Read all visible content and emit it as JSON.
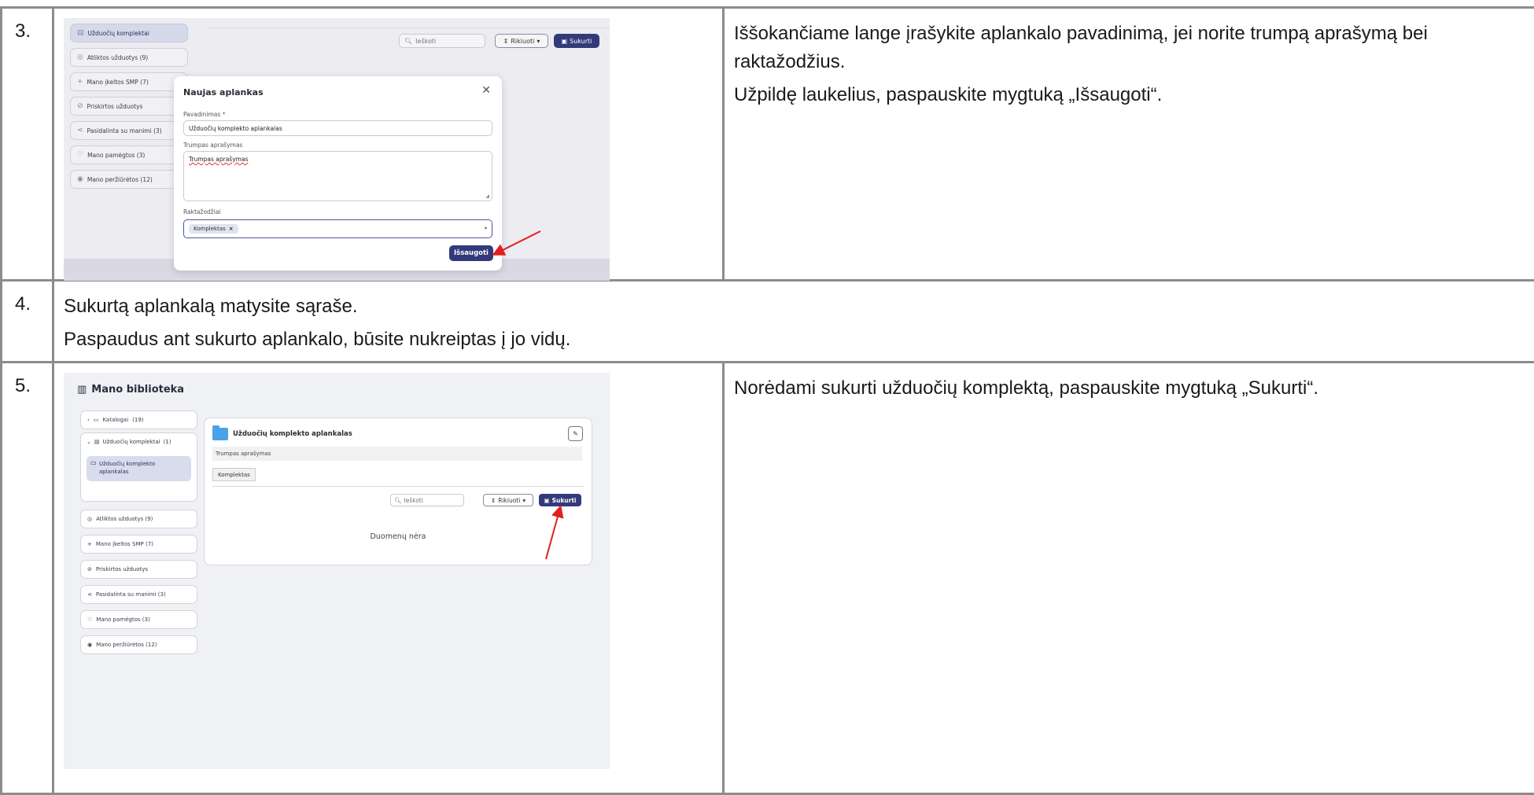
{
  "rows": [
    {
      "number": "3.",
      "text": [
        "Iššokančiame lange įrašykite aplankalo pavadinimą, jei norite trumpą aprašymą bei raktažodžius.",
        "Užpildę laukelius, paspauskite mygtuką „Išsaugoti“."
      ]
    },
    {
      "number": "4.",
      "text": [
        "Sukurtą aplankalą matysite sąraše.",
        "Paspaudus ant sukurto aplankalo, būsite nukreiptas į jo vidų."
      ]
    },
    {
      "number": "5.",
      "text": [
        "Norėdami sukurti užduočių komplektą, paspauskite mygtuką „Sukurti“."
      ]
    }
  ],
  "screenshot3": {
    "sidebar": [
      "Užduočių komplektai",
      "Atliktos užduotys (9)",
      "Mano įkeltos SMP (7)",
      "Priskirtos užduotys",
      "Pasidalinta su manimi (3)",
      "Mano pamėgtos (3)",
      "Mano peržiūrėtos (12)"
    ],
    "search_placeholder": "Ieškoti",
    "sort_label": "Rikiuoti",
    "create_label": "Sukurti",
    "modal": {
      "title": "Naujas aplankas",
      "name_label": "Pavadinimas",
      "name_required": "*",
      "name_value": "Užduočių komplekto aplankalas",
      "desc_label": "Trumpas aprašymas",
      "desc_value": "Trumpas aprašymas",
      "keywords_label": "Raktažodžiai",
      "keyword_tag": "Komplektas",
      "tag_remove": "×",
      "save_label": "Išsaugoti"
    },
    "arrow_color": "#e02020"
  },
  "screenshot5": {
    "title": "Mano biblioteka",
    "sidebar": {
      "catalogs": "Katalogai",
      "catalogs_count": "(19)",
      "sets": "Užduočių komplektai",
      "sets_count": "(1)",
      "folder_line1": "Užduočių komplekto",
      "folder_line2": "aplankalas",
      "items": [
        "Atliktos užduotys (9)",
        "Mano įkeltos SMP (7)",
        "Priskirtos užduotys",
        "Pasidalinta su manimi (3)",
        "Mano pamėgtos (3)",
        "Mano peržiūrėtos (12)"
      ]
    },
    "panel": {
      "folder_title": "Užduočių komplekto aplankalas",
      "description": "Trumpas aprašymas",
      "tag": "Komplektas",
      "search_placeholder": "Ieškoti",
      "sort_label": "Rikiuoti",
      "create_label": "Sukurti",
      "empty_text": "Duomenų nėra"
    },
    "accent": "#333a7a"
  }
}
